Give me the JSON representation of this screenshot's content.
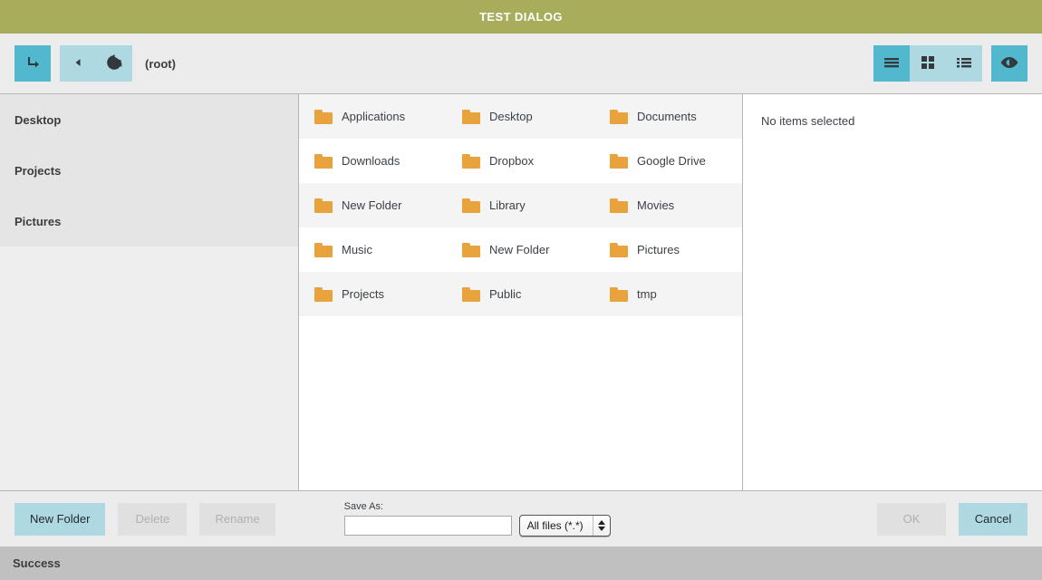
{
  "window": {
    "title": "TEST DIALOG"
  },
  "toolbar": {
    "open_icon": "arrow-turn-down-right-icon",
    "back_icon": "triangle-left-icon",
    "refresh_icon": "refresh-icon",
    "path": "(root)",
    "views": [
      {
        "name": "list-view",
        "icon": "hamburger-list-icon",
        "active": true
      },
      {
        "name": "grid-view",
        "icon": "grid-squares-icon",
        "active": false
      },
      {
        "name": "detail-view",
        "icon": "detail-list-icon",
        "active": false
      }
    ],
    "preview_toggle": {
      "name": "preview-toggle",
      "icon": "eye-icon",
      "active": true
    }
  },
  "sidebar": {
    "items": [
      {
        "label": "Desktop"
      },
      {
        "label": "Projects"
      },
      {
        "label": "Pictures"
      }
    ]
  },
  "filelist": {
    "rows": [
      {
        "cells": [
          {
            "name": "Applications"
          },
          {
            "name": "Desktop"
          },
          {
            "name": "Documents"
          }
        ]
      },
      {
        "cells": [
          {
            "name": "Downloads"
          },
          {
            "name": "Dropbox"
          },
          {
            "name": "Google Drive"
          }
        ]
      },
      {
        "cells": [
          {
            "name": "New Folder"
          },
          {
            "name": "Library"
          },
          {
            "name": "Movies"
          }
        ]
      },
      {
        "cells": [
          {
            "name": "Music"
          },
          {
            "name": "New Folder"
          },
          {
            "name": "Pictures"
          }
        ]
      },
      {
        "cells": [
          {
            "name": "Projects"
          },
          {
            "name": "Public"
          },
          {
            "name": "tmp"
          }
        ]
      }
    ]
  },
  "preview": {
    "message": "No items selected"
  },
  "actions": {
    "new_folder": {
      "label": "New Folder",
      "enabled": true
    },
    "delete": {
      "label": "Delete",
      "enabled": false
    },
    "rename": {
      "label": "Rename",
      "enabled": false
    },
    "save_as_label": "Save As:",
    "save_as_value": "",
    "save_as_placeholder": "",
    "filter": {
      "selected": "All files (*.*)"
    },
    "ok": {
      "label": "OK",
      "enabled": false
    },
    "cancel": {
      "label": "Cancel",
      "enabled": true
    }
  },
  "status": {
    "message": "Success"
  },
  "colors": {
    "title_bar": "#a8ad5c",
    "accent_active": "#52b8ce",
    "accent_light": "#aed9e3",
    "folder": "#e8a33d",
    "status_bar": "#c0c0c0"
  }
}
